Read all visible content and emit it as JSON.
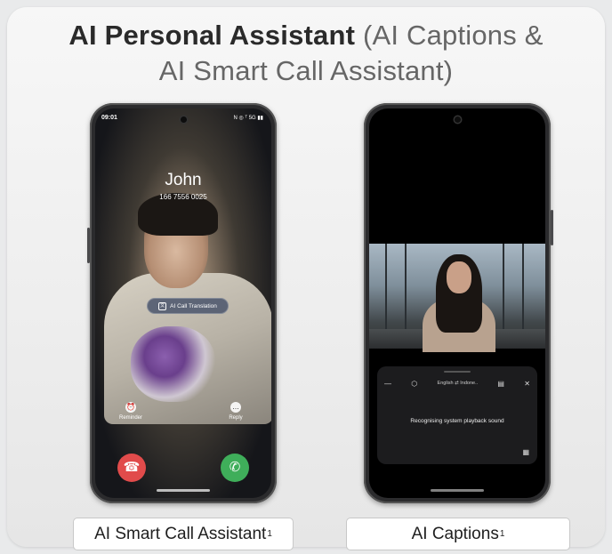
{
  "title": {
    "bold": "AI Personal Assistant",
    "light": "(AI Captions &",
    "line2": "AI Smart Call Assistant)"
  },
  "call_screen": {
    "status_time": "09:01",
    "status_icons": "N ◎ ᵀ 5G ▮▮",
    "caller_name": "John",
    "caller_number": "166 7556 0025",
    "translation_pill": "AI Call Translation",
    "reminder_label": "Reminder",
    "reply_label": "Reply",
    "icons": {
      "reminder": "alarm-icon",
      "reply": "message-icon",
      "decline": "phone-down-icon",
      "accept": "phone-icon"
    },
    "colors": {
      "decline": "#e14b4b",
      "accept": "#3fae5a"
    }
  },
  "captions_screen": {
    "language_pair": "English ⇄ Indone..",
    "panel_text": "Recognising system playback sound",
    "icons": [
      "minimize-icon",
      "settings-icon",
      "layout-icon",
      "close-icon",
      "grid-icon"
    ]
  },
  "labels": {
    "left": "AI Smart Call Assistant",
    "left_sup": "1",
    "right": "AI Captions",
    "right_sup": "1"
  }
}
